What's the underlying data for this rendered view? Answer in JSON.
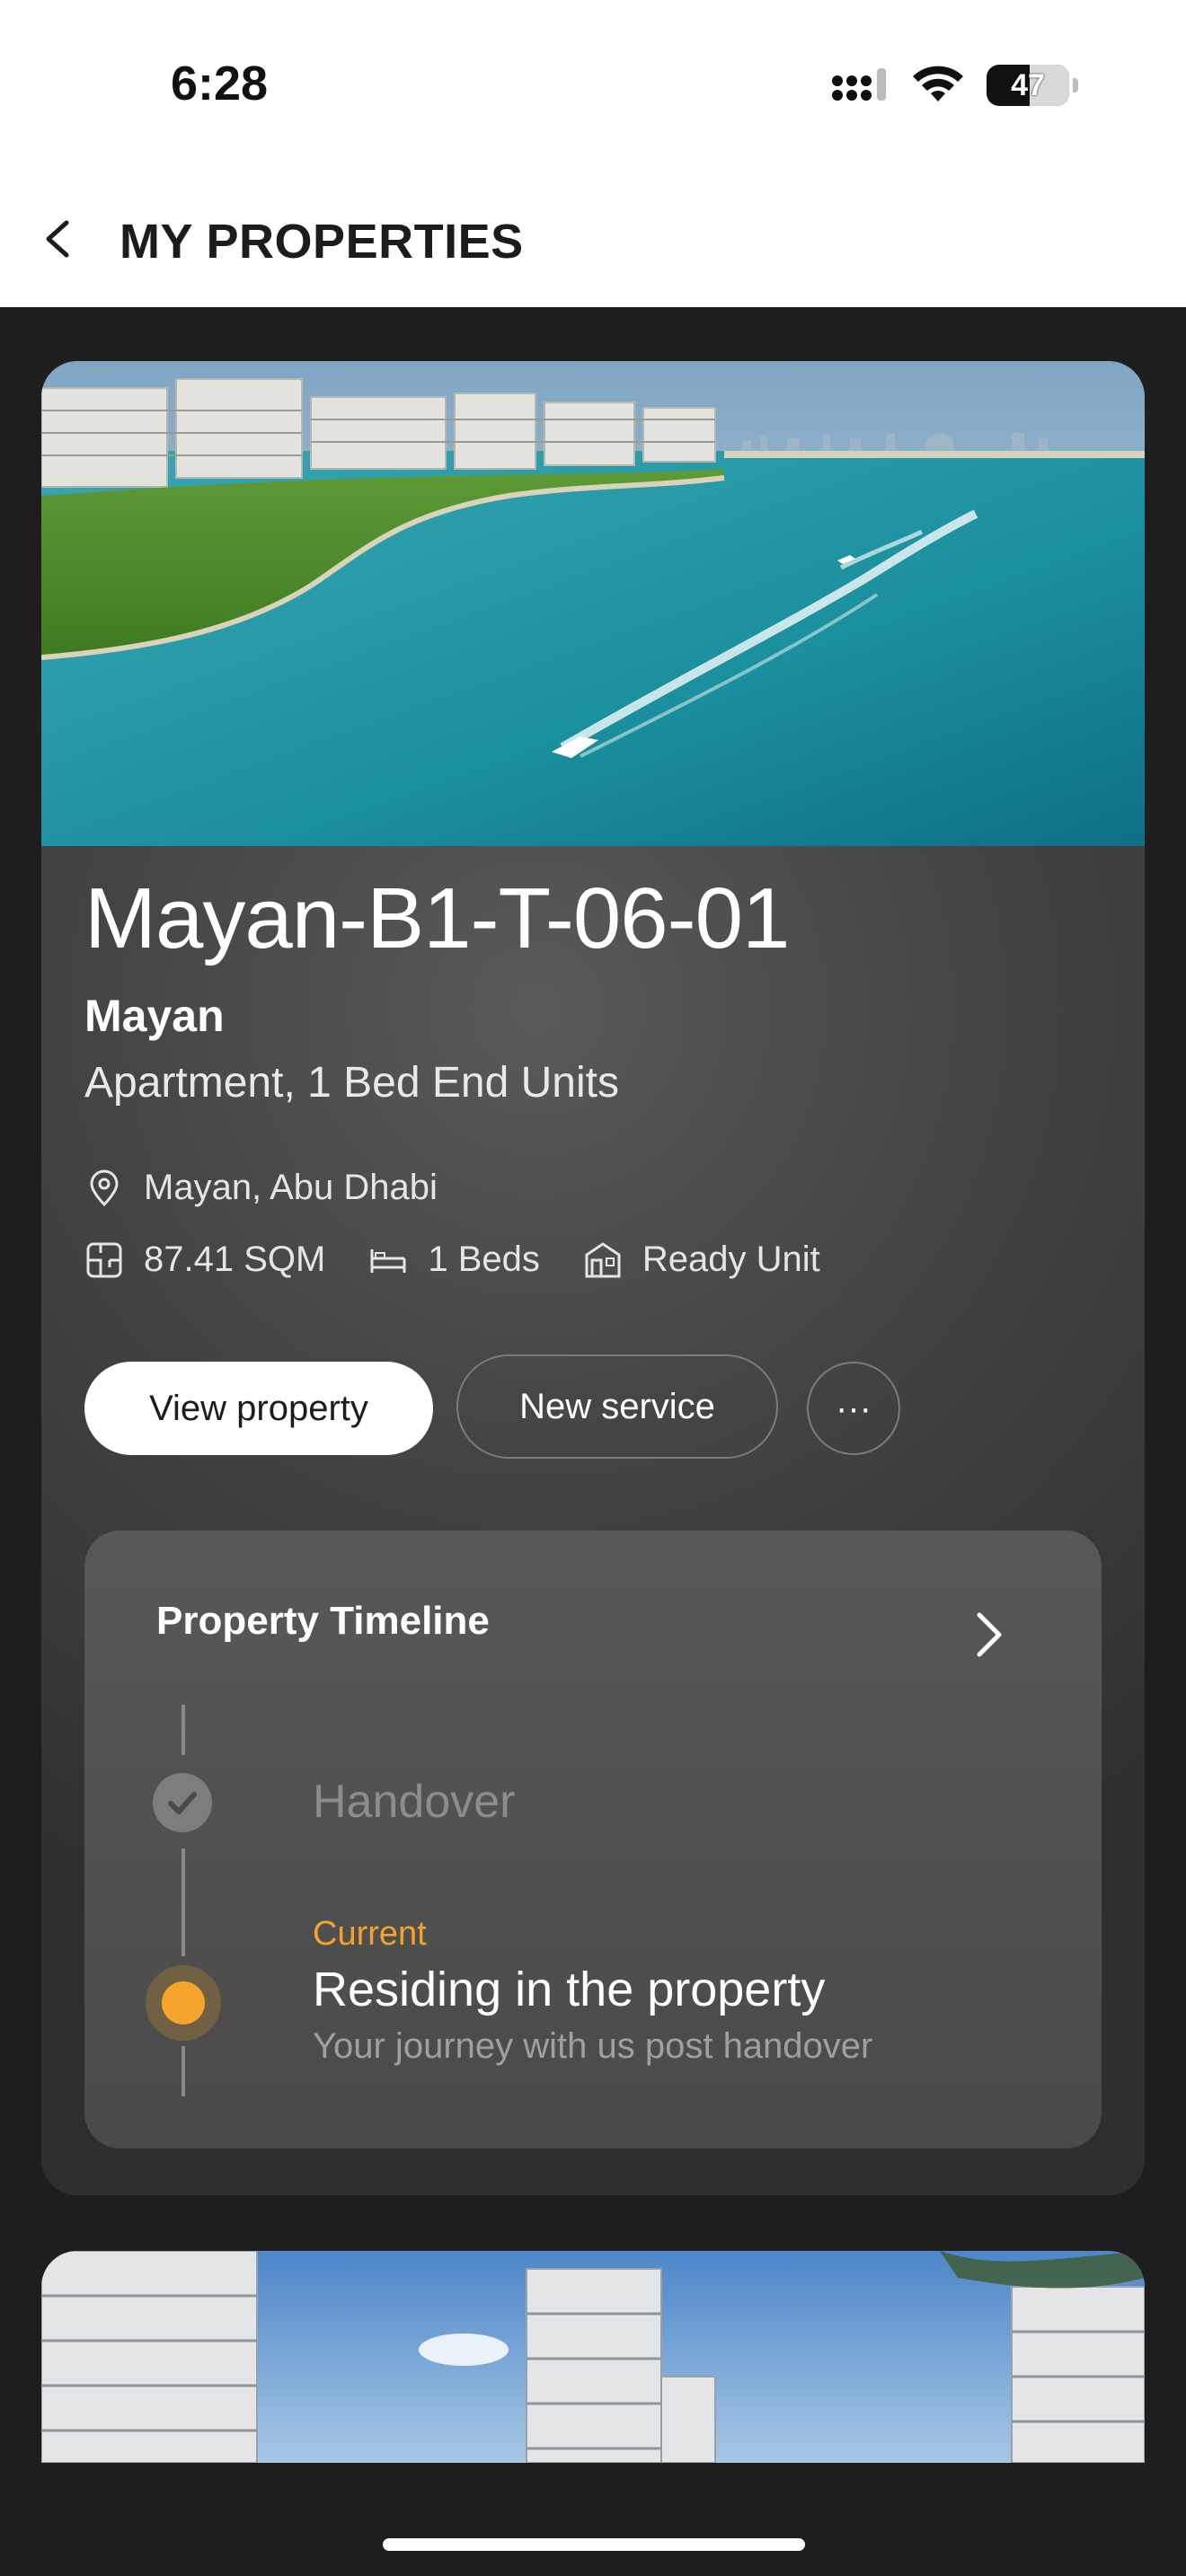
{
  "status_bar": {
    "time": "6:28",
    "battery": "47"
  },
  "header": {
    "title": "MY PROPERTIES"
  },
  "property": {
    "unit_name": "Mayan-B1-T-06-01",
    "project": "Mayan",
    "type": "Apartment, 1 Bed End Units",
    "location": "Mayan, Abu Dhabi",
    "area": "87.41 SQM",
    "beds": "1 Beds",
    "status": "Ready Unit",
    "buttons": {
      "view": "View property",
      "new_service": "New service",
      "more": "···"
    }
  },
  "timeline": {
    "title": "Property Timeline",
    "completed_step": "Handover",
    "current_label": "Current",
    "current_step": "Residing in the property",
    "current_desc": "Your journey with us post handover"
  },
  "colors": {
    "accent": "#f5a52c",
    "background": "#1e1e1e",
    "card": "#3a3a3a"
  },
  "icons": [
    "back-chevron-icon",
    "location-pin-icon",
    "floorplan-icon",
    "bed-icon",
    "building-status-icon",
    "chevron-right-icon",
    "check-icon"
  ]
}
